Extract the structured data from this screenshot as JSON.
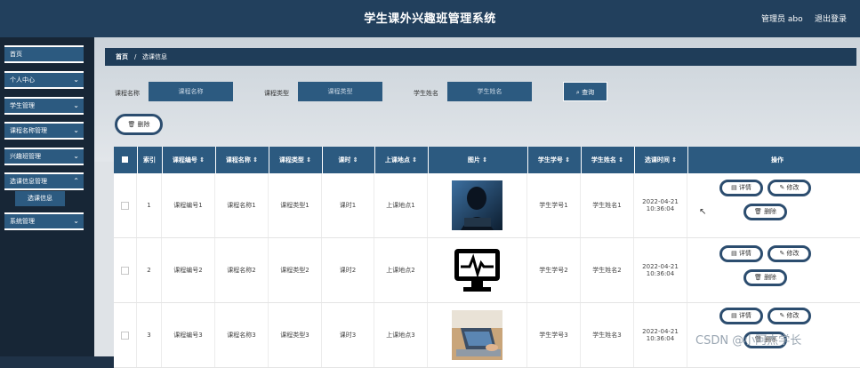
{
  "header": {
    "title": "学生课外兴趣班管理系统",
    "user": "管理员 abo",
    "logout": "退出登录"
  },
  "sidebar": {
    "items": [
      {
        "label": "首页",
        "chevron": false
      },
      {
        "label": "个人中心",
        "chevron": true
      },
      {
        "label": "学生管理",
        "chevron": true
      },
      {
        "label": "课程名称管理",
        "chevron": true
      },
      {
        "label": "兴趣班管理",
        "chevron": true
      },
      {
        "label": "选课信息管理",
        "chevron": true
      },
      {
        "label": "系统管理",
        "chevron": true
      }
    ],
    "sub_item": "选课信息"
  },
  "breadcrumb": {
    "home": "首页",
    "sep": "/",
    "current": "选课信息"
  },
  "filters": {
    "course_name_label": "课程名称",
    "course_name_placeholder": "课程名称",
    "course_type_label": "课程类型",
    "course_type_placeholder": "课程类型",
    "student_name_label": "学生姓名",
    "student_name_placeholder": "学生姓名",
    "search": "查询"
  },
  "toolbar": {
    "delete": "删除"
  },
  "table": {
    "headers": [
      "索引",
      "课程编号 ⇕",
      "课程名称 ⇕",
      "课程类型 ⇕",
      "课时 ⇕",
      "上课地点 ⇕",
      "图片 ⇕",
      "学生学号 ⇕",
      "学生姓名 ⇕",
      "选课时间 ⇕",
      "操作"
    ],
    "rows": [
      {
        "index": "1",
        "code": "课程编号1",
        "name": "课程名称1",
        "type": "课程类型1",
        "hours": "课时1",
        "place": "上课地点1",
        "image": "hacker",
        "sid": "学生学号1",
        "sname": "学生姓名1",
        "time": "2022-04-21 10:36:04"
      },
      {
        "index": "2",
        "code": "课程编号2",
        "name": "课程名称2",
        "type": "课程类型2",
        "hours": "课时2",
        "place": "上课地点2",
        "image": "monitor",
        "sid": "学生学号2",
        "sname": "学生姓名2",
        "time": "2022-04-21 10:36:04"
      },
      {
        "index": "3",
        "code": "课程编号3",
        "name": "课程名称3",
        "type": "课程类型3",
        "hours": "课时3",
        "place": "上课地点3",
        "image": "laptop",
        "sid": "学生学号3",
        "sname": "学生姓名3",
        "time": "2022-04-21 10:36:04"
      }
    ],
    "actions": {
      "detail": "详情",
      "edit": "修改",
      "delete": "删除"
    }
  },
  "watermark": "CSDN @小阿杰学长",
  "colors": {
    "header": "#22405d",
    "accent": "#2c5a80",
    "sidebar": "#172636"
  }
}
